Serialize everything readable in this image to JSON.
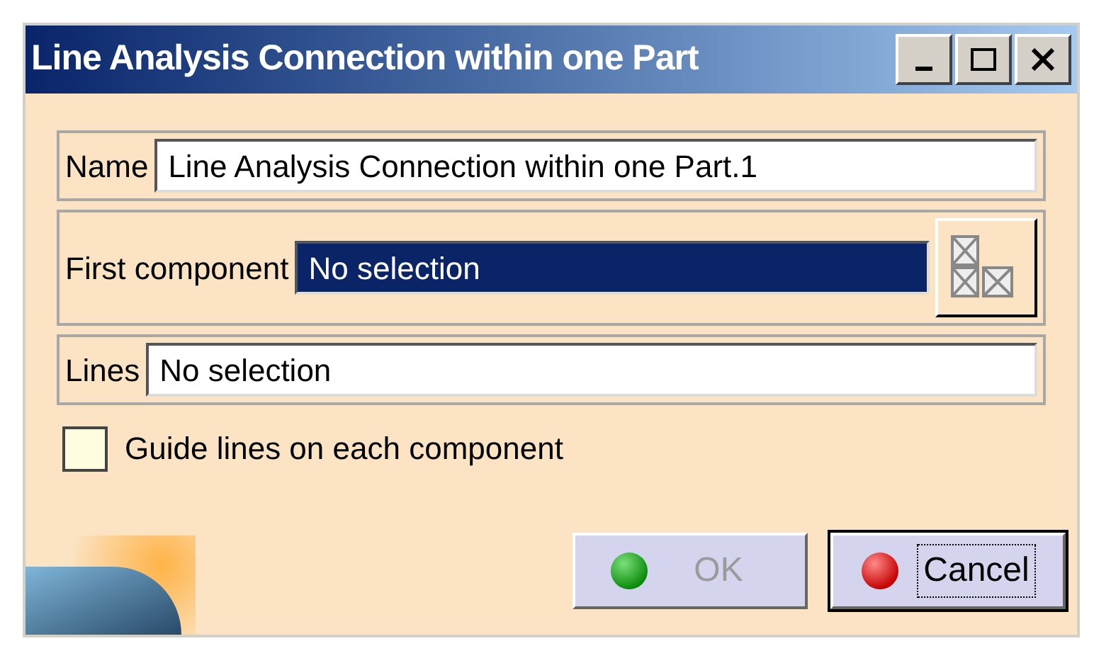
{
  "window": {
    "title": "Line Analysis Connection within one Part"
  },
  "fields": [
    {
      "kind": "text",
      "label": "Name",
      "value": "Line Analysis Connection within one Part.1",
      "selected": false
    },
    {
      "kind": "selector",
      "label": "First component",
      "value": "No selection",
      "selected": true
    },
    {
      "kind": "text",
      "label": "Lines",
      "value": "No selection",
      "selected": false
    }
  ],
  "checkbox": {
    "label": "Guide lines on each component",
    "checked": false
  },
  "buttons": [
    {
      "kind": "ok",
      "label": "OK",
      "disabled": true,
      "focused": false
    },
    {
      "kind": "cancel",
      "label": "Cancel",
      "disabled": false,
      "focused": true
    }
  ]
}
